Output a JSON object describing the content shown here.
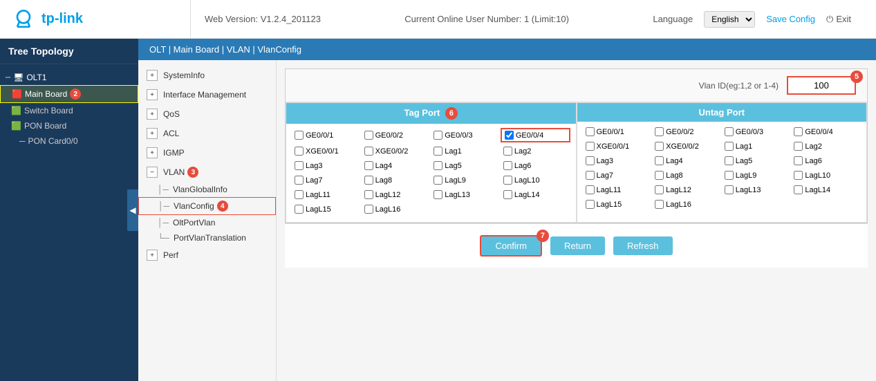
{
  "header": {
    "logo_text": "tp-link",
    "web_version_label": "Web Version: V1.2.4_201123",
    "online_users": "Current Online User Number: 1 (Limit:10)",
    "language_label": "Language",
    "language_value": "English",
    "save_config_label": "Save Config",
    "exit_label": "Exit"
  },
  "sidebar": {
    "title": "Tree Topology",
    "nodes": [
      {
        "label": "OLT",
        "indent": 0,
        "badge": "1"
      },
      {
        "label": "Main Board",
        "indent": 1,
        "badge": "2"
      },
      {
        "label": "Switch Board",
        "indent": 1
      },
      {
        "label": "PON Board",
        "indent": 1
      },
      {
        "label": "PON Card0/0",
        "indent": 2
      }
    ]
  },
  "breadcrumb": "OLT | Main Board | VLAN | VlanConfig",
  "left_menu": {
    "items": [
      {
        "label": "SystemInfo"
      },
      {
        "label": "Interface Management"
      },
      {
        "label": "QoS"
      },
      {
        "label": "ACL"
      },
      {
        "label": "IGMP"
      },
      {
        "label": "VLAN",
        "badge": "3",
        "expanded": true
      }
    ],
    "vlan_subitems": [
      {
        "label": "VlanGlobalInfo"
      },
      {
        "label": "VlanConfig",
        "active": true,
        "badge": "4"
      },
      {
        "label": "OltPortVlan"
      },
      {
        "label": "PortVlanTranslation"
      }
    ],
    "perf_item": {
      "label": "Perf"
    }
  },
  "vlan_config": {
    "vlan_id_label": "Vlan ID(eg:1,2 or 1-4)",
    "vlan_id_value": "100",
    "badge_5": "5",
    "badge_6": "6",
    "tag_port_label": "Tag Port",
    "untag_port_label": "Untag Port",
    "tag_ports": [
      {
        "id": "GE0/0/1",
        "checked": false
      },
      {
        "id": "GE0/0/2",
        "checked": false
      },
      {
        "id": "GE0/0/3",
        "checked": false
      },
      {
        "id": "GE0/0/4",
        "checked": true
      },
      {
        "id": "XGE0/0/1",
        "checked": false
      },
      {
        "id": "XGE0/0/2",
        "checked": false
      },
      {
        "id": "Lag1",
        "checked": false
      },
      {
        "id": "Lag2",
        "checked": false
      },
      {
        "id": "Lag3",
        "checked": false
      },
      {
        "id": "Lag4",
        "checked": false
      },
      {
        "id": "Lag5",
        "checked": false
      },
      {
        "id": "Lag6",
        "checked": false
      },
      {
        "id": "Lag7",
        "checked": false
      },
      {
        "id": "Lag8",
        "checked": false
      },
      {
        "id": "LagL9",
        "checked": false
      },
      {
        "id": "LagL10",
        "checked": false
      },
      {
        "id": "LagL11",
        "checked": false
      },
      {
        "id": "LagL12",
        "checked": false
      },
      {
        "id": "LagL13",
        "checked": false
      },
      {
        "id": "LagL14",
        "checked": false
      },
      {
        "id": "LagL15",
        "checked": false
      },
      {
        "id": "LagL16",
        "checked": false
      }
    ],
    "untag_ports": [
      {
        "id": "GE0/0/1",
        "checked": false
      },
      {
        "id": "GE0/0/2",
        "checked": false
      },
      {
        "id": "GE0/0/3",
        "checked": false
      },
      {
        "id": "GE0/0/4",
        "checked": false
      },
      {
        "id": "XGE0/0/1",
        "checked": false
      },
      {
        "id": "XGE0/0/2",
        "checked": false
      },
      {
        "id": "Lag1",
        "checked": false
      },
      {
        "id": "Lag2",
        "checked": false
      },
      {
        "id": "Lag3",
        "checked": false
      },
      {
        "id": "Lag4",
        "checked": false
      },
      {
        "id": "Lag5",
        "checked": false
      },
      {
        "id": "Lag6",
        "checked": false
      },
      {
        "id": "Lag7",
        "checked": false
      },
      {
        "id": "Lag8",
        "checked": false
      },
      {
        "id": "LagL9",
        "checked": false
      },
      {
        "id": "LagL10",
        "checked": false
      },
      {
        "id": "LagL11",
        "checked": false
      },
      {
        "id": "LagL12",
        "checked": false
      },
      {
        "id": "LagL13",
        "checked": false
      },
      {
        "id": "LagL14",
        "checked": false
      },
      {
        "id": "LagL15",
        "checked": false
      },
      {
        "id": "LagL16",
        "checked": false
      }
    ]
  },
  "buttons": {
    "confirm_label": "Confirm",
    "return_label": "Return",
    "refresh_label": "Refresh",
    "badge_7": "7"
  }
}
